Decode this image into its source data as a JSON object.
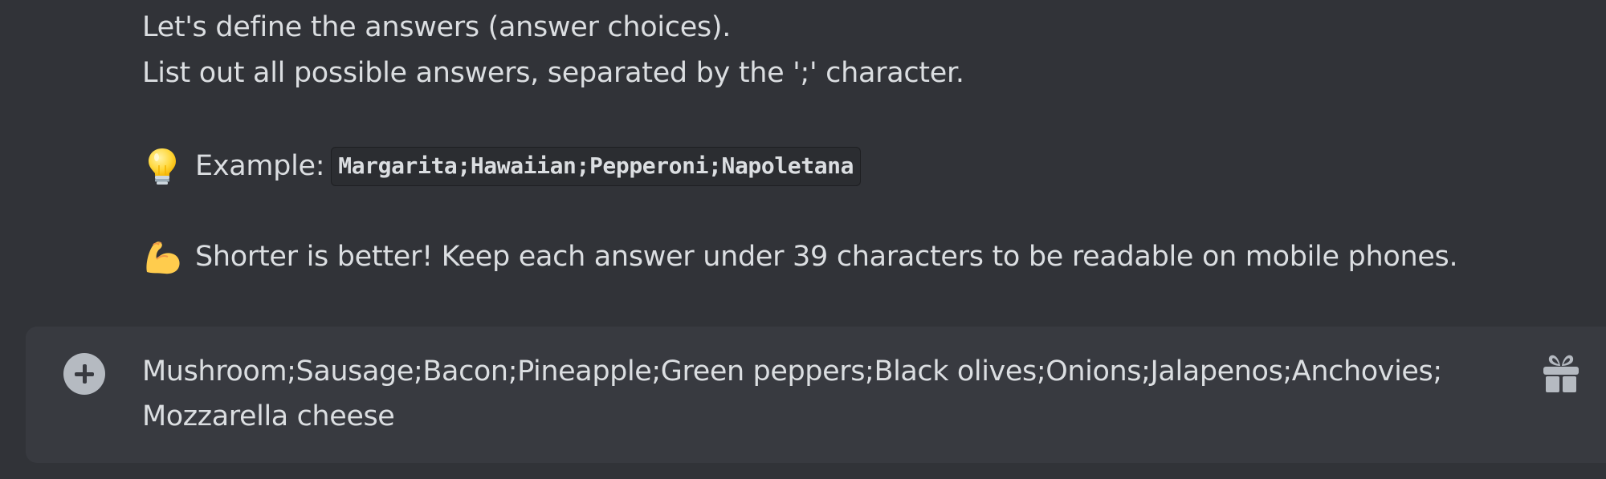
{
  "message": {
    "line1": "Let's define the answers (answer choices).",
    "line2": "List out all possible answers, separated by the ';' character.",
    "example": {
      "icon": "lightbulb-icon",
      "label": "Example:",
      "code": "Margarita;Hawaiian;Pepperoni;Napoletana"
    },
    "tip": {
      "icon": "flexed-biceps-icon",
      "text": "Shorter is better! Keep each answer under 39 characters to be readable on mobile phones."
    }
  },
  "composer": {
    "plus_icon": "plus-circle-icon",
    "value": "Mushroom;Sausage;Bacon;Pineapple;Green peppers;Black olives;Onions;Jalapenos;Anchovies;\nMozzarella cheese",
    "gift_icon": "gift-icon"
  },
  "colors": {
    "background": "#313338",
    "composer_bg": "#383a40",
    "text": "#dbdee1",
    "icon": "#b5bac1",
    "code_bg": "#2b2d31"
  }
}
